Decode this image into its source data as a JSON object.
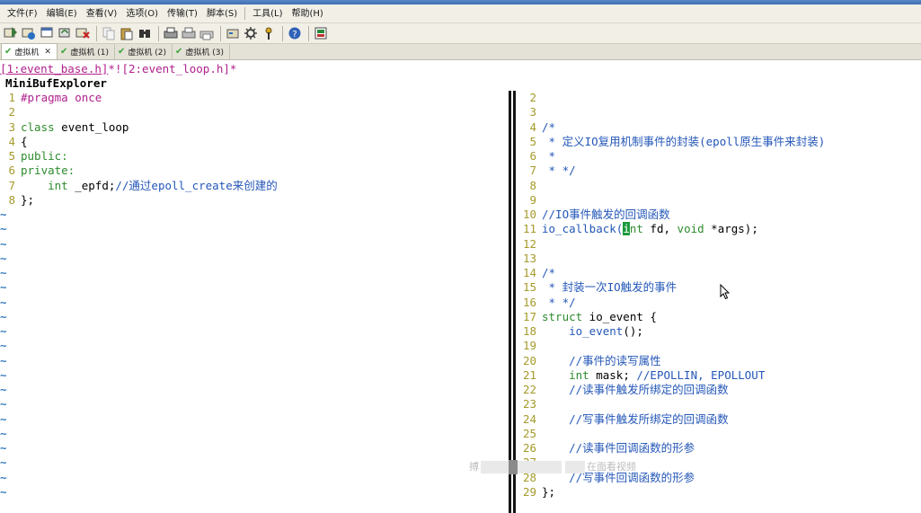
{
  "menu": [
    "文件(F)",
    "编辑(E)",
    "查看(V)",
    "选项(O)",
    "传输(T)",
    "脚本(S)",
    "工具(L)",
    "帮助(H)"
  ],
  "tabs": [
    {
      "label": "虚拟机",
      "close": "✕"
    },
    {
      "label": "虚拟机 (1)"
    },
    {
      "label": "虚拟机 (2)"
    },
    {
      "label": "虚拟机 (3)"
    }
  ],
  "buffer_line": {
    "buf1": "[1:event_base.h]",
    "mid": "*!",
    "buf2": "[2:event_loop.h]",
    "tail": "*"
  },
  "minibuf_title": "MiniBufExplorer",
  "left_lines": [
    {
      "n": "1",
      "parts": [
        [
          "pp",
          "#pragma once"
        ]
      ]
    },
    {
      "n": "2",
      "parts": []
    },
    {
      "n": "3",
      "parts": [
        [
          "kw",
          "class"
        ],
        [
          "tx",
          " event_loop"
        ]
      ]
    },
    {
      "n": "4",
      "parts": [
        [
          "tx",
          "{"
        ]
      ]
    },
    {
      "n": "5",
      "parts": [
        [
          "kw",
          "public:"
        ]
      ]
    },
    {
      "n": "6",
      "parts": [
        [
          "kw",
          "private:"
        ]
      ]
    },
    {
      "n": "7",
      "parts": [
        [
          "tx",
          "    "
        ],
        [
          "kw",
          "int"
        ],
        [
          "tx",
          " _epfd;"
        ],
        [
          "cm",
          "//通过epoll_create来创建的"
        ]
      ]
    },
    {
      "n": "8",
      "parts": [
        [
          "tx",
          "};"
        ]
      ]
    }
  ],
  "tilde": "~",
  "right_lines": [
    {
      "n": "2",
      "parts": []
    },
    {
      "n": "3",
      "parts": []
    },
    {
      "n": "4",
      "parts": [
        [
          "cm",
          "/*"
        ]
      ]
    },
    {
      "n": "5",
      "parts": [
        [
          "cm",
          " * 定义IO复用机制事件的封装(epoll原生事件来封装)"
        ]
      ]
    },
    {
      "n": "6",
      "parts": [
        [
          "cm",
          " *"
        ]
      ]
    },
    {
      "n": "7",
      "parts": [
        [
          "cm",
          " * */"
        ]
      ]
    },
    {
      "n": "8",
      "parts": []
    },
    {
      "n": "9",
      "parts": []
    },
    {
      "n": "10",
      "parts": [
        [
          "cm",
          "//IO事件触发的回调函数"
        ]
      ]
    },
    {
      "n": "11",
      "parts": [
        [
          "fn",
          "io_callback("
        ],
        [
          "cursor",
          "i"
        ],
        [
          "kw",
          "nt"
        ],
        [
          "tx",
          " fd, "
        ],
        [
          "kw",
          "void"
        ],
        [
          "tx",
          " *args);"
        ]
      ]
    },
    {
      "n": "12",
      "parts": []
    },
    {
      "n": "13",
      "parts": []
    },
    {
      "n": "14",
      "parts": [
        [
          "cm",
          "/*"
        ]
      ]
    },
    {
      "n": "15",
      "parts": [
        [
          "cm",
          " * 封装一次IO触发的事件"
        ]
      ]
    },
    {
      "n": "16",
      "parts": [
        [
          "cm",
          " * */"
        ]
      ]
    },
    {
      "n": "17",
      "parts": [
        [
          "kw",
          "struct"
        ],
        [
          "tx",
          " io_event {"
        ]
      ]
    },
    {
      "n": "18",
      "parts": [
        [
          "tx",
          "    "
        ],
        [
          "fn",
          "io_event"
        ],
        [
          "tx",
          "();"
        ]
      ]
    },
    {
      "n": "19",
      "parts": []
    },
    {
      "n": "20",
      "parts": [
        [
          "tx",
          "    "
        ],
        [
          "cm",
          "//事件的读写属性"
        ]
      ]
    },
    {
      "n": "21",
      "parts": [
        [
          "tx",
          "    "
        ],
        [
          "kw",
          "int"
        ],
        [
          "tx",
          " mask; "
        ],
        [
          "cm",
          "//EPOLLIN, EPOLLOUT"
        ]
      ]
    },
    {
      "n": "22",
      "parts": [
        [
          "tx",
          "    "
        ],
        [
          "cm",
          "//读事件触发所绑定的回调函数"
        ]
      ]
    },
    {
      "n": "23",
      "parts": []
    },
    {
      "n": "24",
      "parts": [
        [
          "tx",
          "    "
        ],
        [
          "cm",
          "//写事件触发所绑定的回调函数"
        ]
      ]
    },
    {
      "n": "25",
      "parts": []
    },
    {
      "n": "26",
      "parts": [
        [
          "tx",
          "    "
        ],
        [
          "cm",
          "//读事件回调函数的形参"
        ]
      ]
    },
    {
      "n": "27",
      "parts": []
    },
    {
      "n": "28",
      "parts": [
        [
          "tx",
          "    "
        ],
        [
          "cm",
          "//写事件回调函数的形参"
        ]
      ]
    },
    {
      "n": "29",
      "parts": [
        [
          "tx",
          "};"
        ]
      ]
    }
  ],
  "watermark": {
    "left": "搏",
    "right": "在面看视频"
  }
}
